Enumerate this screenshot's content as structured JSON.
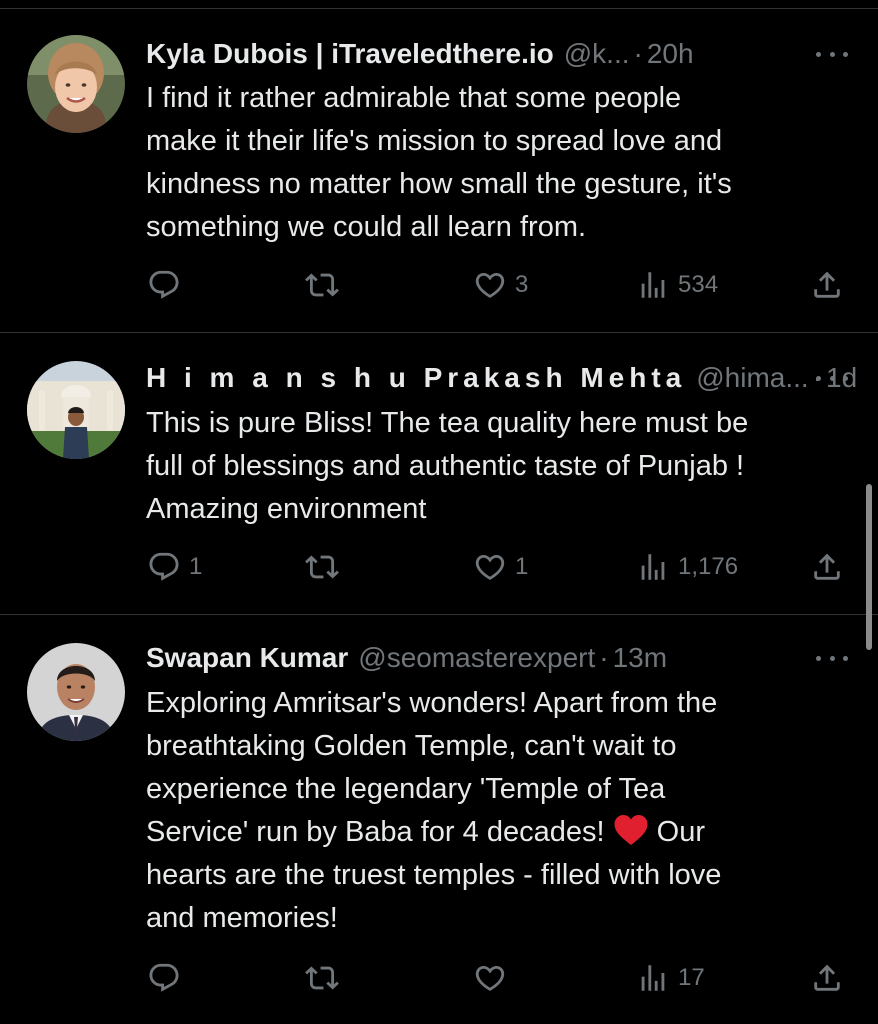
{
  "tweets": [
    {
      "name": "Kyla Dubois | iTraveledthere.io",
      "handle": "@k...",
      "time": "20h",
      "text": "I find it rather admirable that some people\nmake it their life's mission to spread love and\nkindness no matter how small the gesture, it's\nsomething we could all learn from.",
      "replies": "",
      "retweets": "",
      "likes": "3",
      "views": "534"
    },
    {
      "name": "H i m a n s h u Prakash Mehta",
      "handle": "@hima...",
      "time": "1d",
      "text": "This is pure Bliss! The tea quality here must be\nfull of blessings and authentic taste of Punjab !\nAmazing environment",
      "replies": "1",
      "retweets": "",
      "likes": "1",
      "views": "1,176"
    },
    {
      "name": "Swapan Kumar",
      "handle": "@seomasterexpert",
      "time": "13m",
      "text_before_emoji": "Exploring Amritsar's wonders! Apart from the\nbreathtaking Golden Temple, can't wait to\nexperience the legendary 'Temple of Tea\nService' run by Baba for 4 decades! ",
      "text_after_emoji": " Our\nhearts are the truest temples - filled with love\nand memories!",
      "emoji": "red-heart-emoji",
      "replies": "",
      "retweets": "",
      "likes": "",
      "views": "17"
    }
  ],
  "separator_dot": "·",
  "colors": {
    "background": "#000000",
    "text": "#e7e9ea",
    "secondary": "#71767b",
    "divider": "#2f3336",
    "heart_emoji": "#e0202e"
  },
  "icons": [
    "reply-icon",
    "retweet-icon",
    "like-icon",
    "views-icon",
    "share-icon",
    "more-icon"
  ]
}
